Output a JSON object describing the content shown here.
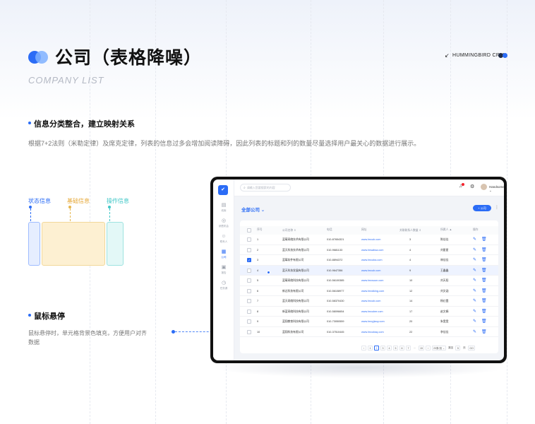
{
  "header": {
    "title": "公司（表格降噪）",
    "subtitle": "COMPANY LIST",
    "brand": "HUMMINGBIRD CRM"
  },
  "section1": {
    "title": "信息分类整合，建立映射关系",
    "desc": "根据7+2法则（米勒定律）及席克定律，列表的信息过多会增加阅读障碍，因此列表的标题和列的数量尽量选择用户最关心的数据进行展示。"
  },
  "legend": {
    "status": "状态信息",
    "basic": "基础信息",
    "action": "操作信息",
    "colors": {
      "status": "#2b6cf6",
      "basic": "#e6b64c",
      "action": "#3fc7c7"
    }
  },
  "section2": {
    "title": "鼠标悬停",
    "desc": "鼠标悬停时，单元格背景色填充，方便用户对齐数据"
  },
  "app": {
    "logo_glyph": "✔",
    "search_placeholder": "请输入您要搜索的内容",
    "user": "Handsome_om ⌄",
    "nav": [
      {
        "icon": "▤",
        "label": "线索"
      },
      {
        "icon": "◎",
        "label": "销售机会"
      },
      {
        "icon": "☺",
        "label": "联系人"
      },
      {
        "icon": "▦",
        "label": "公司"
      },
      {
        "icon": "▣",
        "label": "报告"
      },
      {
        "icon": "◷",
        "label": "任务源"
      }
    ],
    "filter_label": "全部公司 ⌄",
    "new_button": "+ 公司",
    "columns": [
      "序号",
      "公司名称 ⇕",
      "电话",
      "网址",
      "关联联系人数量 ⇕",
      "所属人 ▲",
      "操作"
    ],
    "rows": [
      {
        "no": "1",
        "name": "蓝莓网络技术有限公司",
        "phone": "010-87654321",
        "site": "www.lmcub.com",
        "count": "3",
        "owner": "陈佳佳",
        "checked": false
      },
      {
        "no": "2",
        "name": "蓝天科技技术有限公司",
        "phone": "010-9681133",
        "site": "www.lmsabsa.com",
        "count": "4",
        "owner": "刘星星",
        "checked": false
      },
      {
        "no": "3",
        "name": "蓝莓软件有限公司",
        "phone": "010-8894372",
        "site": "www.lmcuba.com",
        "count": "4",
        "owner": "林佳佳",
        "checked": true
      },
      {
        "no": "4",
        "name": "蓝天科技发展有限公司",
        "phone": "010-9647356",
        "site": "www.lmcub.com",
        "count": "9",
        "owner": "王鑫鑫",
        "checked": false
      },
      {
        "no": "5",
        "name": "蓝莓网络科技有限公司",
        "phone": "010-56100385",
        "site": "www.lmcsuun.com",
        "count": "10",
        "owner": "刘天阳",
        "checked": false
      },
      {
        "no": "6",
        "name": "新达科技有限公司",
        "phone": "010-56108977",
        "site": "www.lmxdking.com",
        "count": "12",
        "owner": "刘文涵",
        "checked": false
      },
      {
        "no": "7",
        "name": "蓝天网络科技有限公司",
        "phone": "010-58370430",
        "site": "www.lmcub.com",
        "count": "14",
        "owner": "杨红霞",
        "checked": false
      },
      {
        "no": "8",
        "name": "新蓝网络科技有限公司",
        "phone": "010-58096654",
        "site": "www.lmcuber.com",
        "count": "17",
        "owner": "赵文娟",
        "checked": false
      },
      {
        "no": "9",
        "name": "蓝翔教育科技有限公司",
        "phone": "010-73050559",
        "site": "www.lmxyjiaoy.com",
        "count": "20",
        "owner": "朱雯雯",
        "checked": false
      },
      {
        "no": "10",
        "name": "蓝翔科技有限公司",
        "phone": "010-37510445",
        "site": "www.lmcubaq.com",
        "count": "22",
        "owner": "李佳佳",
        "checked": false
      }
    ],
    "pagination": [
      "‹",
      "1",
      "2",
      "3",
      "4",
      "5",
      "6",
      "7",
      "...",
      "15",
      "›",
      "20条/页 ⌄",
      "跳至",
      "5",
      "页",
      "GO"
    ],
    "pagination_current": "2"
  }
}
